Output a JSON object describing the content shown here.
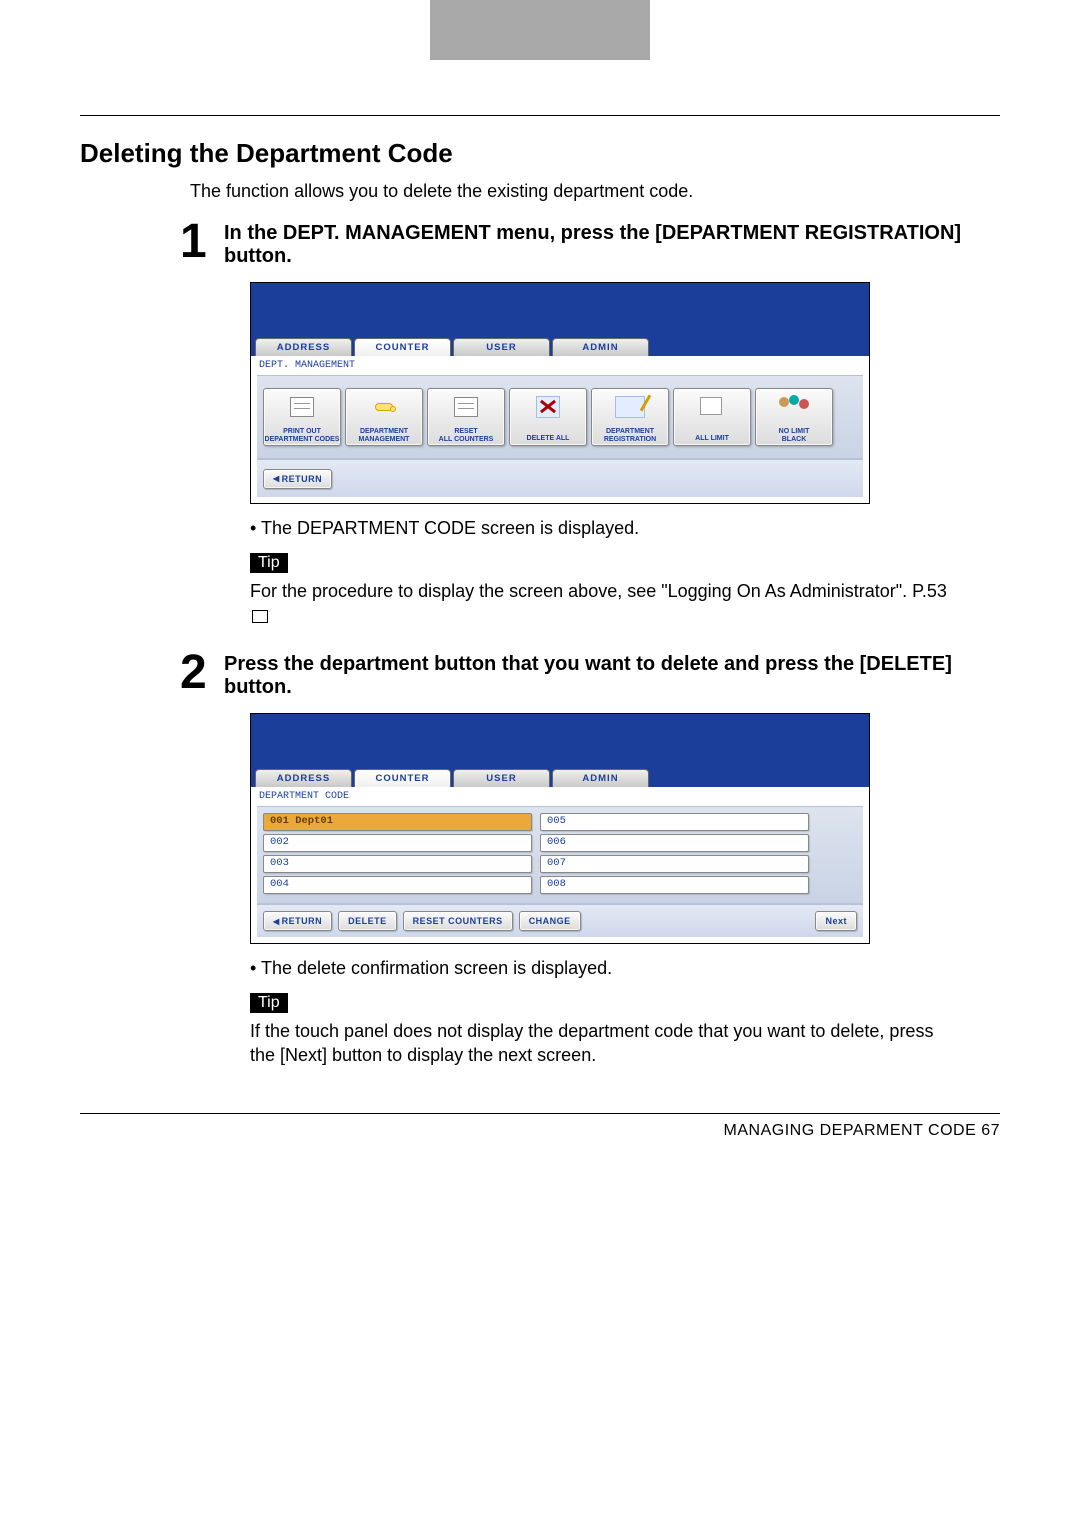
{
  "heading": "Deleting the Department Code",
  "intro": "The function allows you to delete the existing department code.",
  "steps": [
    {
      "num": "1",
      "text": "In the DEPT. MANAGEMENT menu, press the [DEPARTMENT REGISTRATION] button."
    },
    {
      "num": "2",
      "text": "Press the department button that you want to delete and press the [DELETE] button."
    }
  ],
  "bullets": [
    "The DEPARTMENT CODE screen is displayed.",
    "The delete confirmation screen is displayed."
  ],
  "tip_label": "Tip",
  "tips": [
    "For the procedure to display the screen above, see \"Logging On As Administrator\".      P.53",
    "If the touch panel does not display the department code that you want to delete, press the [Next] button to display the next screen."
  ],
  "screen1": {
    "tabs": [
      "ADDRESS",
      "COUNTER",
      "USER",
      "ADMIN"
    ],
    "breadcrumb": "DEPT. MANAGEMENT",
    "big_buttons": [
      {
        "l1": "PRINT OUT",
        "l2": "DEPARTMENT CODES",
        "icon": "sheet"
      },
      {
        "l1": "DEPARTMENT",
        "l2": "MANAGEMENT",
        "icon": "key"
      },
      {
        "l1": "RESET",
        "l2": "ALL COUNTERS",
        "icon": "sheet"
      },
      {
        "l1": "DELETE ALL",
        "l2": "",
        "icon": "eraser"
      },
      {
        "l1": "DEPARTMENT",
        "l2": "REGISTRATION",
        "icon": "note"
      },
      {
        "l1": "ALL LIMIT",
        "l2": "",
        "icon": "stack"
      },
      {
        "l1": "NO LIMIT",
        "l2": "BLACK",
        "icon": "people"
      }
    ],
    "return": "RETURN"
  },
  "screen2": {
    "tabs": [
      "ADDRESS",
      "COUNTER",
      "USER",
      "ADMIN"
    ],
    "breadcrumb": "DEPARTMENT CODE",
    "col1": [
      "001 Dept01",
      "002",
      "003",
      "004"
    ],
    "col2": [
      "005",
      "006",
      "007",
      "008"
    ],
    "actions": {
      "return": "RETURN",
      "delete": "DELETE",
      "reset": "RESET COUNTERS",
      "change": "CHANGE",
      "next": "Next"
    }
  },
  "footer": "MANAGING DEPARMENT CODE    67"
}
